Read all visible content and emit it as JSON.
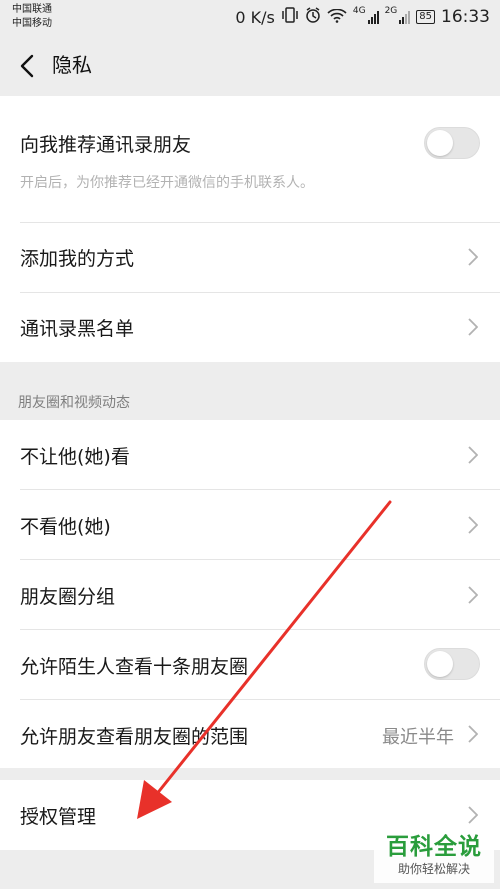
{
  "status_bar": {
    "carrier_1": "中国联通",
    "carrier_2": "中国移动",
    "net_speed": "0 K/s",
    "sig_4g": "4G",
    "sig_2g": "2G",
    "battery": "85",
    "time": "16:33"
  },
  "nav": {
    "title": "隐私",
    "back_icon": "chevron-left-icon"
  },
  "items": {
    "recommend_contacts": {
      "label": "向我推荐通讯录朋友",
      "desc": "开启后，为你推荐已经开通微信的手机联系人。",
      "toggle_on": false
    },
    "add_methods": {
      "label": "添加我的方式"
    },
    "contacts_blacklist": {
      "label": "通讯录黑名单"
    }
  },
  "moments_section": {
    "title": "朋友圈和视频动态",
    "items": {
      "hide_from": {
        "label": "不让他(她)看"
      },
      "dont_see": {
        "label": "不看他(她)"
      },
      "groups": {
        "label": "朋友圈分组"
      },
      "strangers_ten": {
        "label": "允许陌生人查看十条朋友圈",
        "toggle_on": false
      },
      "visible_range": {
        "label": "允许朋友查看朋友圈的范围",
        "value": "最近半年"
      }
    }
  },
  "auth_management": {
    "label": "授权管理"
  },
  "watermark": {
    "main": "百科全说",
    "sub": "助你轻松解决"
  },
  "colors": {
    "background": "#ededed",
    "toggle_off": "#e6e6e6",
    "annotation_arrow": "#e8312a",
    "watermark_green": "#2a9d3c"
  }
}
